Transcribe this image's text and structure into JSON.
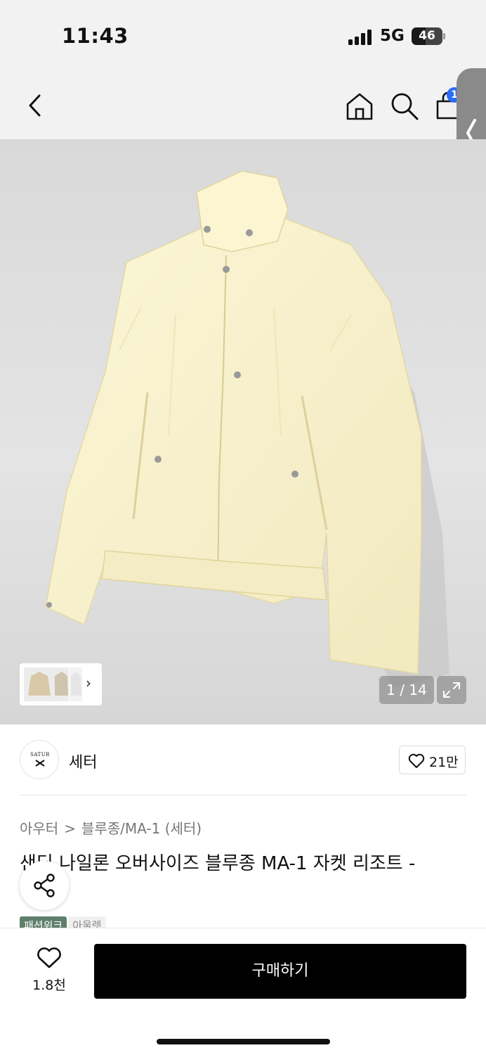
{
  "status_bar": {
    "time": "11:43",
    "network": "5G",
    "battery": "46",
    "battery_level": 0.46
  },
  "header": {
    "back_icon": "chevron-left-icon",
    "home_icon": "home-icon",
    "search_icon": "search-icon",
    "cart_icon": "shopping-bag-icon",
    "cart_badge": "1"
  },
  "side_panel": {
    "icon": "chevron-left-icon"
  },
  "gallery": {
    "counter": "1 / 14",
    "expand_icon": "expand-icon",
    "thumb_arrow": "›"
  },
  "brand": {
    "logo_text": "SATUR",
    "name": "세터",
    "likes": "21만"
  },
  "product": {
    "breadcrumb": [
      "아우터",
      "블루종/MA-1 (세터)"
    ],
    "breadcrumb_separator": ">",
    "title": "샌딩 나일론 오버사이즈 블루종 MA-1 자켓 리조트 -",
    "tags": [
      "패션위크",
      "아울렛"
    ]
  },
  "bottom_bar": {
    "wish_count": "1.8천",
    "buy_label": "구매하기"
  },
  "colors": {
    "accent": "#000000",
    "badge": "#2b6cf6",
    "tag": "#5f7f6a"
  }
}
